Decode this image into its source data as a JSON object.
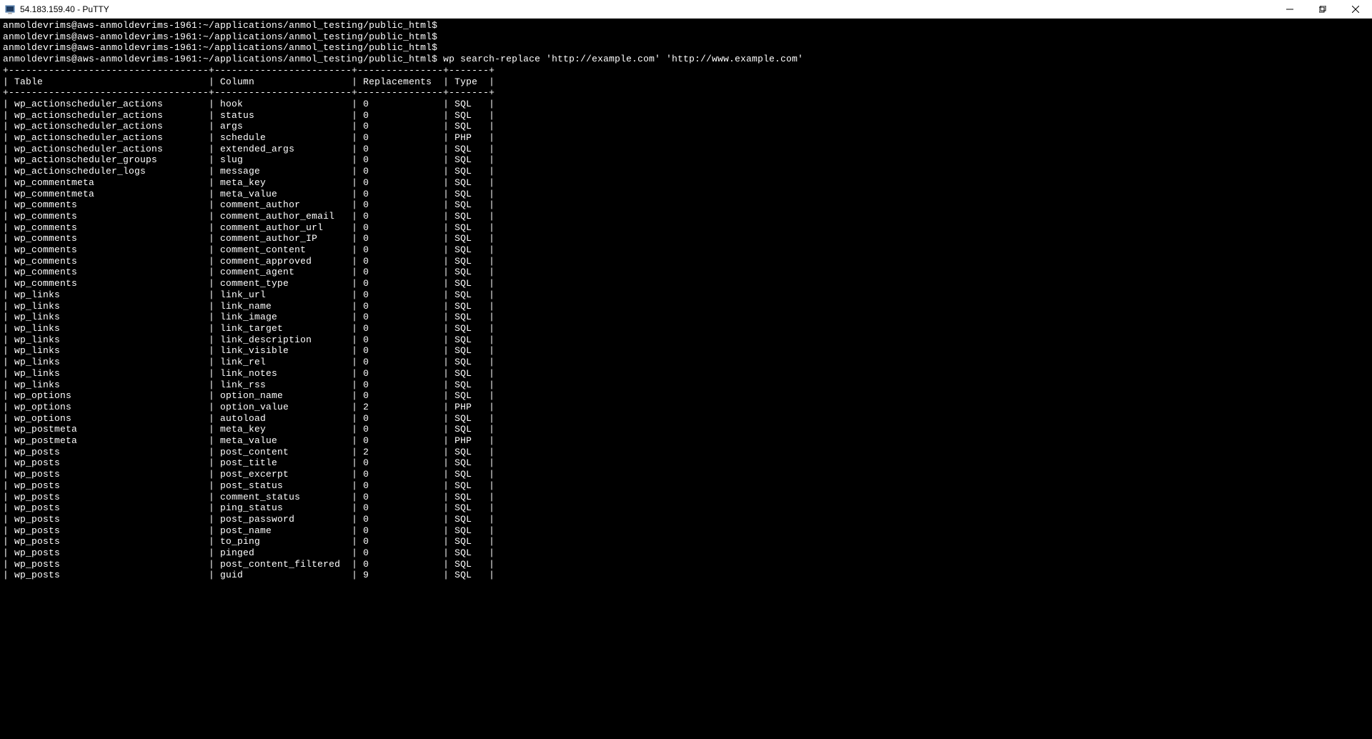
{
  "titlebar": {
    "title": "54.183.159.40 - PuTTY"
  },
  "terminal": {
    "prompt": "anmoldevrims@aws-anmoldevrims-1961:~/applications/anmol_testing/public_html$",
    "blank_prompts": 3,
    "command": "wp search-replace 'http://example.com' 'http://www.example.com'",
    "headers": [
      "Table",
      "Column",
      "Replacements",
      "Type"
    ],
    "rows": [
      {
        "table": "wp_actionscheduler_actions",
        "column": "hook",
        "repl": "0",
        "type": "SQL"
      },
      {
        "table": "wp_actionscheduler_actions",
        "column": "status",
        "repl": "0",
        "type": "SQL"
      },
      {
        "table": "wp_actionscheduler_actions",
        "column": "args",
        "repl": "0",
        "type": "SQL"
      },
      {
        "table": "wp_actionscheduler_actions",
        "column": "schedule",
        "repl": "0",
        "type": "PHP"
      },
      {
        "table": "wp_actionscheduler_actions",
        "column": "extended_args",
        "repl": "0",
        "type": "SQL"
      },
      {
        "table": "wp_actionscheduler_groups",
        "column": "slug",
        "repl": "0",
        "type": "SQL"
      },
      {
        "table": "wp_actionscheduler_logs",
        "column": "message",
        "repl": "0",
        "type": "SQL"
      },
      {
        "table": "wp_commentmeta",
        "column": "meta_key",
        "repl": "0",
        "type": "SQL"
      },
      {
        "table": "wp_commentmeta",
        "column": "meta_value",
        "repl": "0",
        "type": "SQL"
      },
      {
        "table": "wp_comments",
        "column": "comment_author",
        "repl": "0",
        "type": "SQL"
      },
      {
        "table": "wp_comments",
        "column": "comment_author_email",
        "repl": "0",
        "type": "SQL"
      },
      {
        "table": "wp_comments",
        "column": "comment_author_url",
        "repl": "0",
        "type": "SQL"
      },
      {
        "table": "wp_comments",
        "column": "comment_author_IP",
        "repl": "0",
        "type": "SQL"
      },
      {
        "table": "wp_comments",
        "column": "comment_content",
        "repl": "0",
        "type": "SQL"
      },
      {
        "table": "wp_comments",
        "column": "comment_approved",
        "repl": "0",
        "type": "SQL"
      },
      {
        "table": "wp_comments",
        "column": "comment_agent",
        "repl": "0",
        "type": "SQL"
      },
      {
        "table": "wp_comments",
        "column": "comment_type",
        "repl": "0",
        "type": "SQL"
      },
      {
        "table": "wp_links",
        "column": "link_url",
        "repl": "0",
        "type": "SQL"
      },
      {
        "table": "wp_links",
        "column": "link_name",
        "repl": "0",
        "type": "SQL"
      },
      {
        "table": "wp_links",
        "column": "link_image",
        "repl": "0",
        "type": "SQL"
      },
      {
        "table": "wp_links",
        "column": "link_target",
        "repl": "0",
        "type": "SQL"
      },
      {
        "table": "wp_links",
        "column": "link_description",
        "repl": "0",
        "type": "SQL"
      },
      {
        "table": "wp_links",
        "column": "link_visible",
        "repl": "0",
        "type": "SQL"
      },
      {
        "table": "wp_links",
        "column": "link_rel",
        "repl": "0",
        "type": "SQL"
      },
      {
        "table": "wp_links",
        "column": "link_notes",
        "repl": "0",
        "type": "SQL"
      },
      {
        "table": "wp_links",
        "column": "link_rss",
        "repl": "0",
        "type": "SQL"
      },
      {
        "table": "wp_options",
        "column": "option_name",
        "repl": "0",
        "type": "SQL"
      },
      {
        "table": "wp_options",
        "column": "option_value",
        "repl": "2",
        "type": "PHP"
      },
      {
        "table": "wp_options",
        "column": "autoload",
        "repl": "0",
        "type": "SQL"
      },
      {
        "table": "wp_postmeta",
        "column": "meta_key",
        "repl": "0",
        "type": "SQL"
      },
      {
        "table": "wp_postmeta",
        "column": "meta_value",
        "repl": "0",
        "type": "PHP"
      },
      {
        "table": "wp_posts",
        "column": "post_content",
        "repl": "2",
        "type": "SQL"
      },
      {
        "table": "wp_posts",
        "column": "post_title",
        "repl": "0",
        "type": "SQL"
      },
      {
        "table": "wp_posts",
        "column": "post_excerpt",
        "repl": "0",
        "type": "SQL"
      },
      {
        "table": "wp_posts",
        "column": "post_status",
        "repl": "0",
        "type": "SQL"
      },
      {
        "table": "wp_posts",
        "column": "comment_status",
        "repl": "0",
        "type": "SQL"
      },
      {
        "table": "wp_posts",
        "column": "ping_status",
        "repl": "0",
        "type": "SQL"
      },
      {
        "table": "wp_posts",
        "column": "post_password",
        "repl": "0",
        "type": "SQL"
      },
      {
        "table": "wp_posts",
        "column": "post_name",
        "repl": "0",
        "type": "SQL"
      },
      {
        "table": "wp_posts",
        "column": "to_ping",
        "repl": "0",
        "type": "SQL"
      },
      {
        "table": "wp_posts",
        "column": "pinged",
        "repl": "0",
        "type": "SQL"
      },
      {
        "table": "wp_posts",
        "column": "post_content_filtered",
        "repl": "0",
        "type": "SQL"
      },
      {
        "table": "wp_posts",
        "column": "guid",
        "repl": "9",
        "type": "SQL"
      }
    ]
  }
}
